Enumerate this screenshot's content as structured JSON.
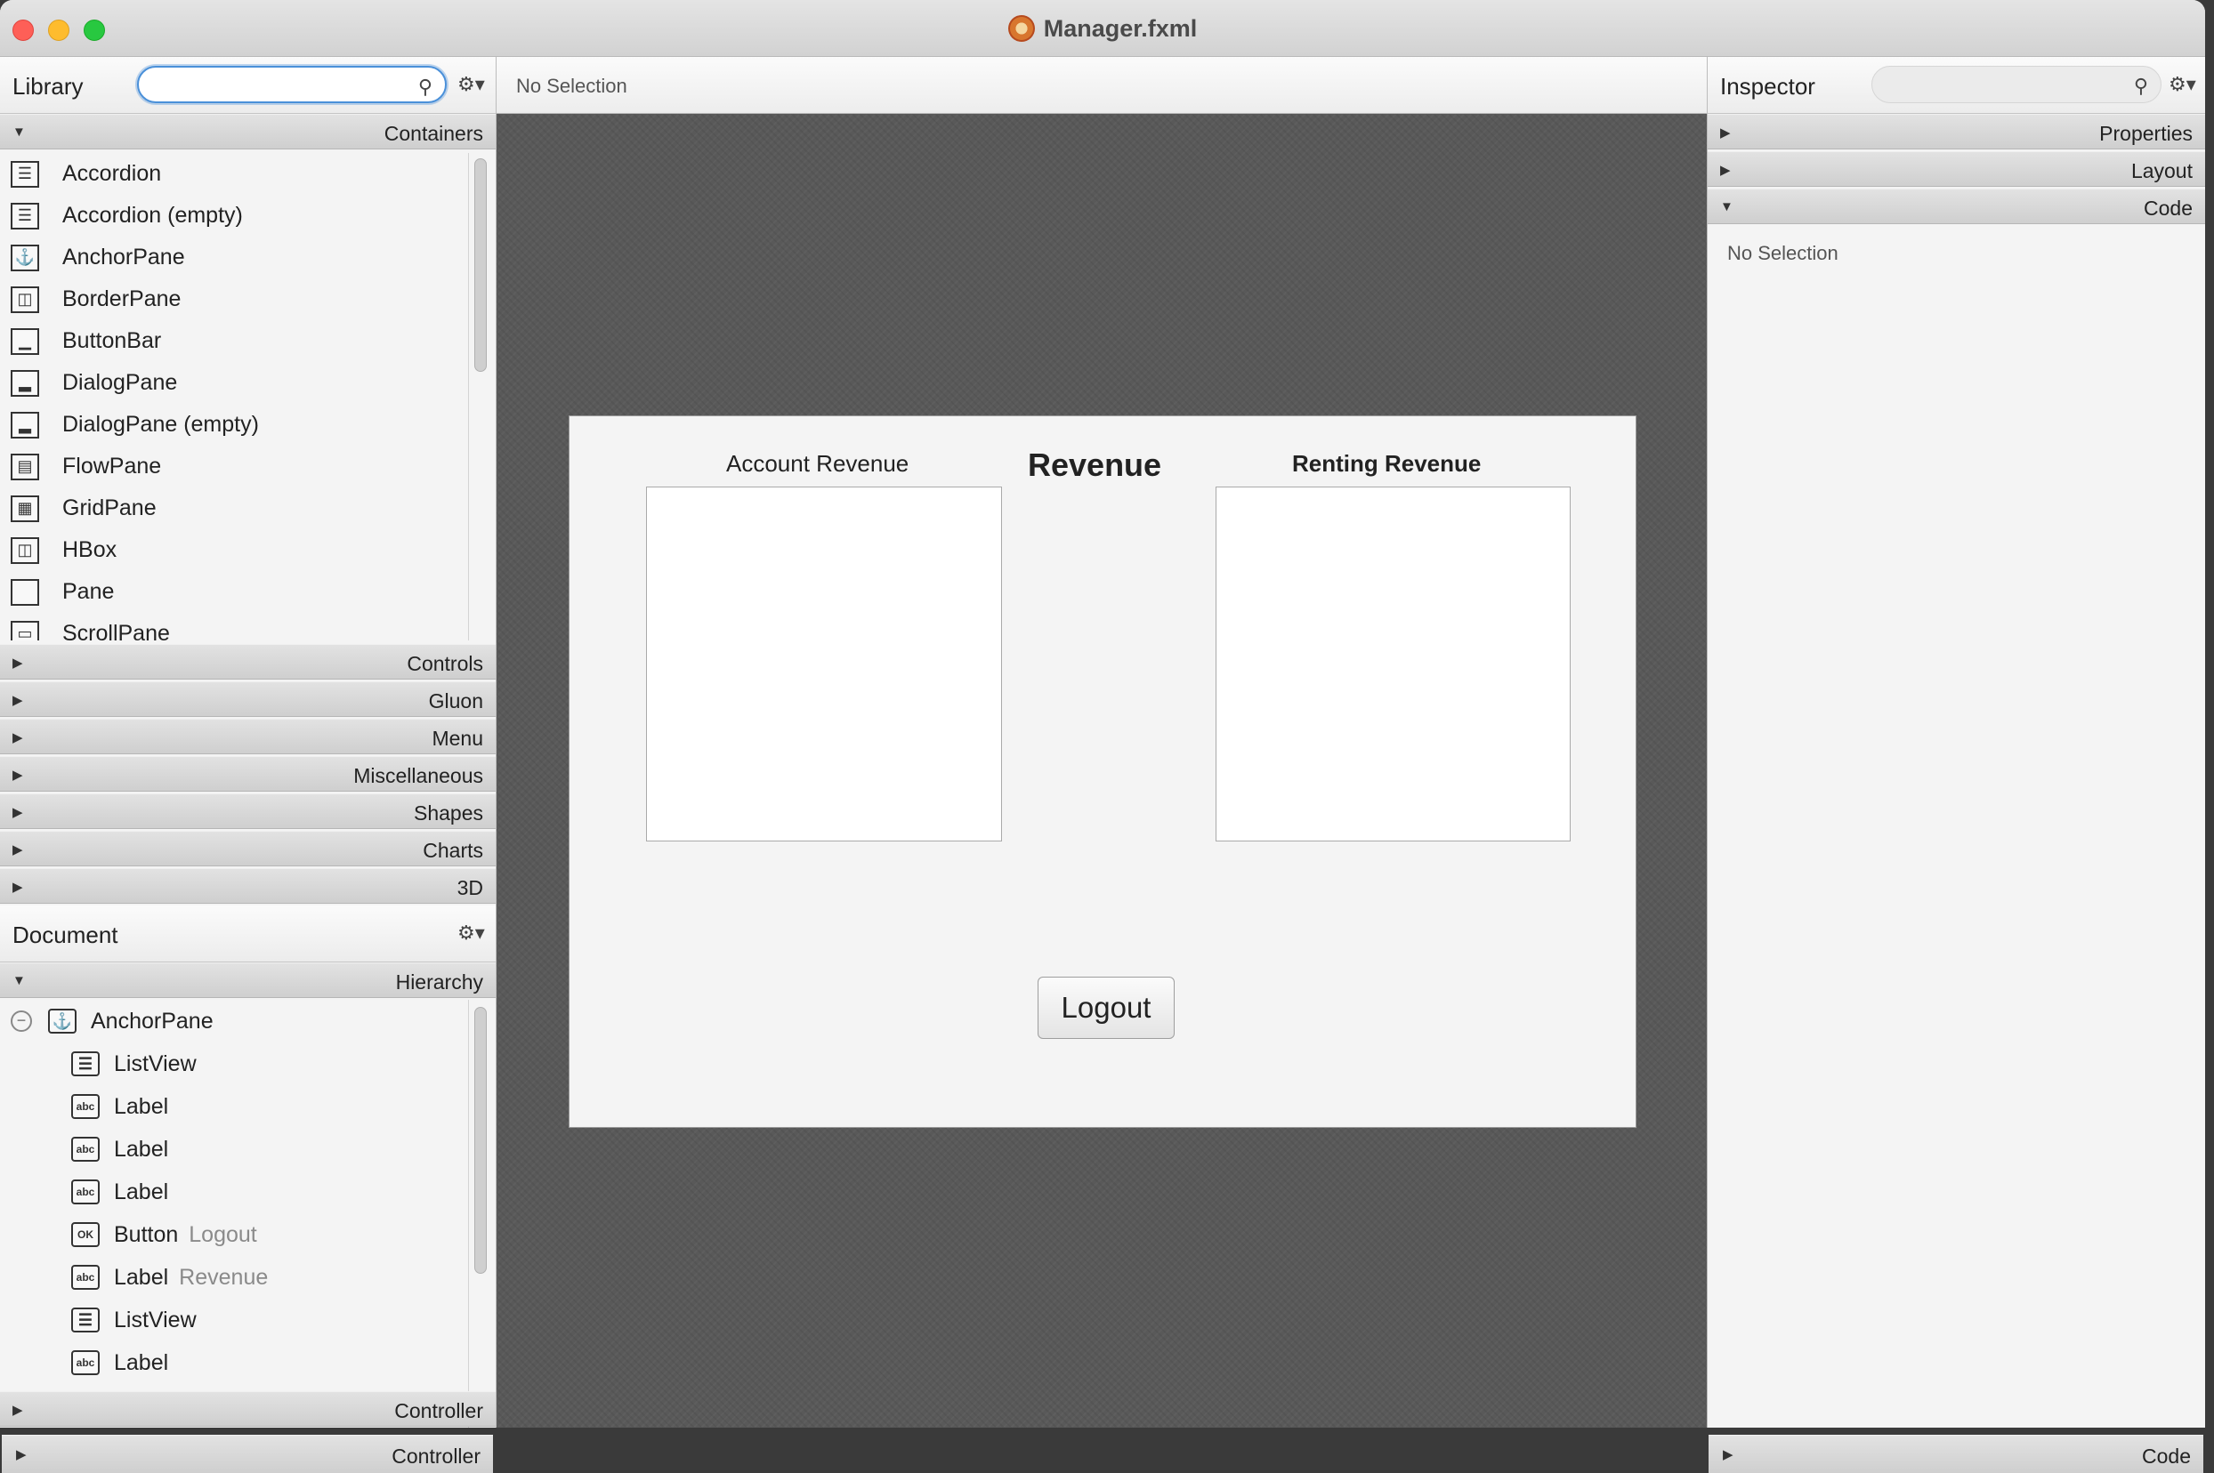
{
  "window": {
    "title": "Manager.fxml"
  },
  "library": {
    "title": "Library",
    "search_placeholder": "",
    "sections": {
      "containers": "Containers",
      "controls": "Controls",
      "gluon": "Gluon",
      "menu": "Menu",
      "misc": "Miscellaneous",
      "shapes": "Shapes",
      "charts": "Charts",
      "three_d": "3D"
    },
    "items": [
      {
        "label": "Accordion",
        "icon": "accordion-icon"
      },
      {
        "label": "Accordion  (empty)",
        "icon": "accordion-icon"
      },
      {
        "label": "AnchorPane",
        "icon": "anchor-icon"
      },
      {
        "label": "BorderPane",
        "icon": "borderpane-icon"
      },
      {
        "label": "ButtonBar",
        "icon": "buttonbar-icon"
      },
      {
        "label": "DialogPane",
        "icon": "dialogpane-icon"
      },
      {
        "label": "DialogPane  (empty)",
        "icon": "dialogpane-icon"
      },
      {
        "label": "FlowPane",
        "icon": "flowpane-icon"
      },
      {
        "label": "GridPane",
        "icon": "gridpane-icon"
      },
      {
        "label": "HBox",
        "icon": "hbox-icon"
      },
      {
        "label": "Pane",
        "icon": "pane-icon"
      },
      {
        "label": "ScrollPane",
        "icon": "scrollpane-icon"
      }
    ]
  },
  "document": {
    "title": "Document",
    "hierarchy_label": "Hierarchy",
    "controller_label": "Controller",
    "tree": [
      {
        "label": "AnchorPane",
        "sub": ""
      },
      {
        "label": "ListView",
        "sub": ""
      },
      {
        "label": "Label",
        "sub": ""
      },
      {
        "label": "Label",
        "sub": ""
      },
      {
        "label": "Label",
        "sub": ""
      },
      {
        "label": "Button",
        "sub": "Logout"
      },
      {
        "label": "Label",
        "sub": "Revenue"
      },
      {
        "label": "ListView",
        "sub": ""
      },
      {
        "label": "Label",
        "sub": ""
      }
    ]
  },
  "center": {
    "status": "No Selection"
  },
  "canvas": {
    "account_label": "Account Revenue",
    "title": "Revenue",
    "renting_label": "Renting Revenue",
    "logout_button": "Logout"
  },
  "inspector": {
    "title": "Inspector",
    "sections": {
      "properties": "Properties",
      "layout": "Layout",
      "code": "Code"
    },
    "no_selection": "No Selection"
  },
  "bottom": {
    "left_label": "Controller",
    "right_label": "Code"
  },
  "colors": {
    "focus_ring": "#4a90d9",
    "close": "#fe5f57",
    "minimize": "#febc2e",
    "zoom": "#28c840"
  }
}
